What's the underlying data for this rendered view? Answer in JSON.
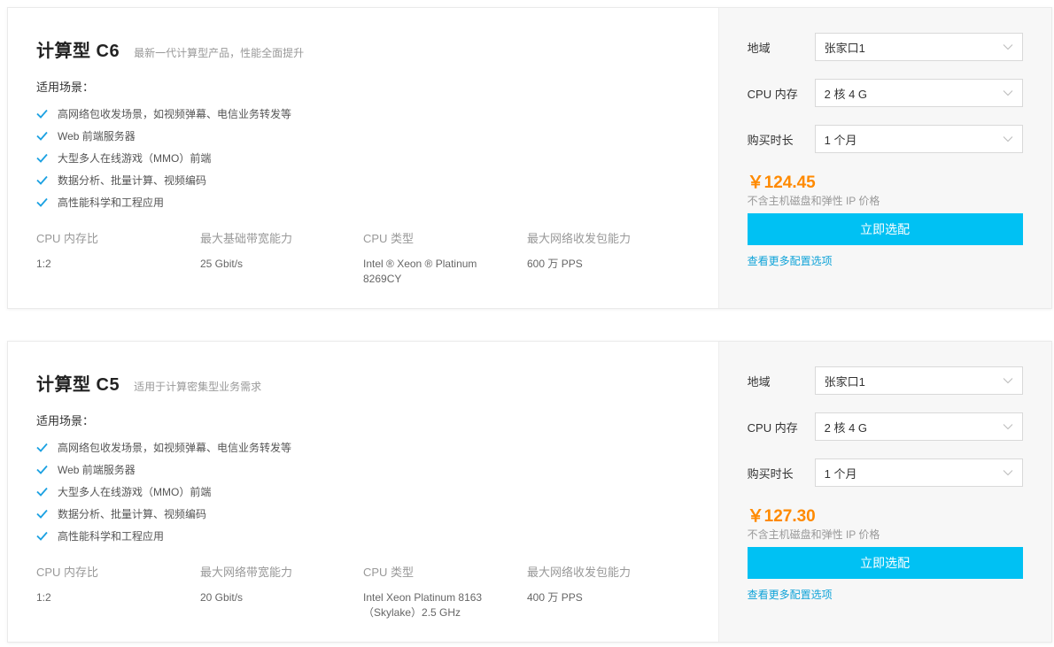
{
  "products": [
    {
      "title": "计算型 C6",
      "subtitle": "最新一代计算型产品，性能全面提升",
      "scenes_label": "适用场景：",
      "scenes": [
        "高网络包收发场景，如视频弹幕、电信业务转发等",
        "Web 前端服务器",
        "大型多人在线游戏（MMO）前端",
        "数据分析、批量计算、视频编码",
        "高性能科学和工程应用"
      ],
      "specs": [
        {
          "label": "CPU 内存比",
          "value": "1:2"
        },
        {
          "label": "最大基础带宽能力",
          "value": "25 Gbit/s"
        },
        {
          "label": "CPU 类型",
          "value": "Intel ® Xeon ® Platinum 8269CY"
        },
        {
          "label": "最大网络收发包能力",
          "value": "600 万 PPS"
        }
      ],
      "config": {
        "region_label": "地域",
        "region_value": "张家口1",
        "cpu_label": "CPU 内存",
        "cpu_value": "2 核 4 G",
        "duration_label": "购买时长",
        "duration_value": "1 个月"
      },
      "price": "￥124.45",
      "price_note": "不含主机磁盘和弹性 IP 价格",
      "buy_label": "立即选配",
      "more_label": "查看更多配置选项"
    },
    {
      "title": "计算型 C5",
      "subtitle": "适用于计算密集型业务需求",
      "scenes_label": "适用场景：",
      "scenes": [
        "高网络包收发场景，如视频弹幕、电信业务转发等",
        "Web 前端服务器",
        "大型多人在线游戏（MMO）前端",
        "数据分析、批量计算、视频编码",
        "高性能科学和工程应用"
      ],
      "specs": [
        {
          "label": "CPU 内存比",
          "value": "1:2"
        },
        {
          "label": "最大网络带宽能力",
          "value": "20 Gbit/s"
        },
        {
          "label": "CPU 类型",
          "value": "Intel Xeon Platinum 8163（Skylake）2.5 GHz"
        },
        {
          "label": "最大网络收发包能力",
          "value": "400 万 PPS"
        }
      ],
      "config": {
        "region_label": "地域",
        "region_value": "张家口1",
        "cpu_label": "CPU 内存",
        "cpu_value": "2 核 4 G",
        "duration_label": "购买时长",
        "duration_value": "1 个月"
      },
      "price": "￥127.30",
      "price_note": "不含主机磁盘和弹性 IP 价格",
      "buy_label": "立即选配",
      "more_label": "查看更多配置选项"
    }
  ],
  "colors": {
    "accent": "#00c1f3",
    "price": "#ff8a00",
    "link": "#0fa3d8",
    "check": "#1ba1e2"
  },
  "icons": {
    "scene_bullet": "check-icon",
    "select_arrow": "chevron-down-icon"
  }
}
